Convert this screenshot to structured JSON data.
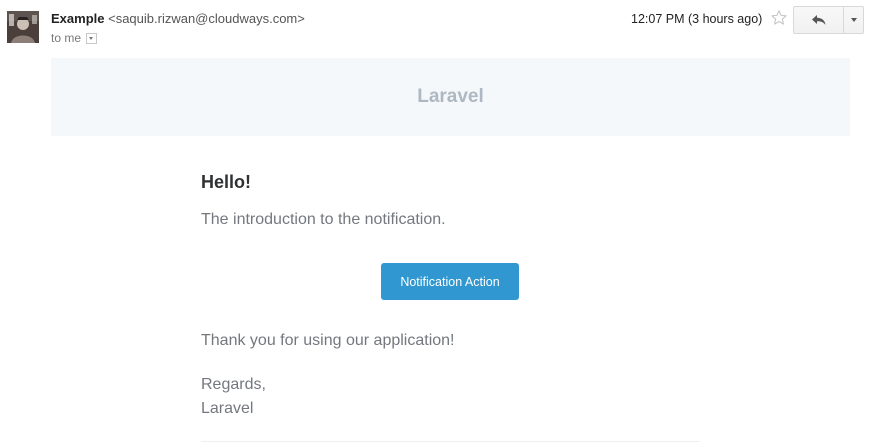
{
  "message_header": {
    "sender_name": "Example",
    "sender_email": "<saquib.rizwan@cloudways.com>",
    "recipient_text": "to me",
    "timestamp": "12:07 PM (3 hours ago)",
    "icons": {
      "avatar": "avatar-image",
      "star": "star-outline-icon",
      "reply": "reply-arrow-icon",
      "more": "chevron-down-icon",
      "recipient_details": "dropdown-arrow-icon"
    }
  },
  "email_body": {
    "brand_title": "Laravel",
    "greeting": "Hello!",
    "intro_line": "The introduction to the notification.",
    "action_label": "Notification Action",
    "outro_line": "Thank you for using our application!",
    "regards_line": "Regards,",
    "signature": "Laravel"
  },
  "colors": {
    "header_band_bg": "#f5f8fa",
    "brand_title": "#aeb8c3",
    "action_button_bg": "#3097d1",
    "body_text": "#74787e",
    "heading_text": "#2f3133"
  }
}
